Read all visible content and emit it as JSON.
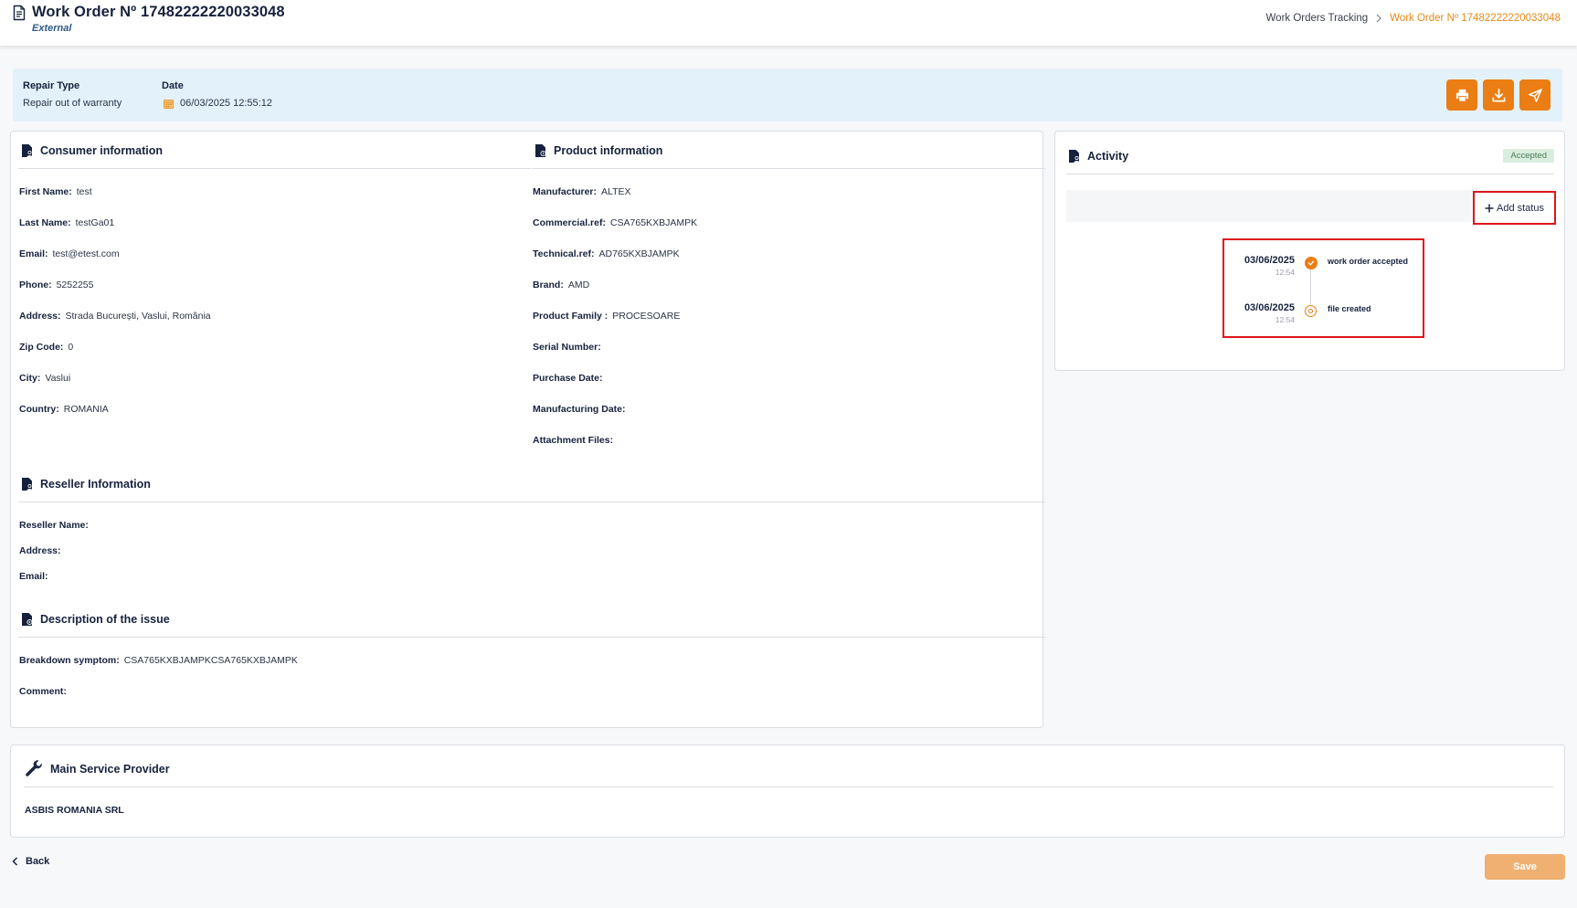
{
  "header": {
    "title": "Work Order Nº 17482222220033048",
    "subtitle": "External",
    "breadcrumb": {
      "parent": "Work Orders Tracking",
      "separator": ">",
      "current": "Work Order Nº 17482222220033048"
    }
  },
  "infobar": {
    "repair_type_label": "Repair Type",
    "repair_type_value": "Repair out of warranty",
    "date_label": "Date",
    "date_value": "06/03/2025 12:55:12",
    "actions": [
      "print-icon",
      "download-icon",
      "send-icon"
    ]
  },
  "consumer": {
    "title": "Consumer information",
    "fields": [
      {
        "label": "First Name:",
        "value": "test"
      },
      {
        "label": "Last Name:",
        "value": "testGa01"
      },
      {
        "label": "Email:",
        "value": "test@etest.com"
      },
      {
        "label": "Phone:",
        "value": "5252255"
      },
      {
        "label": "Address:",
        "value": "Strada București, Vaslui, România"
      },
      {
        "label": "Zip Code:",
        "value": "0"
      },
      {
        "label": "City:",
        "value": "Vaslui"
      },
      {
        "label": "Country:",
        "value": "ROMANIA"
      }
    ]
  },
  "product": {
    "title": "Product information",
    "fields": [
      {
        "label": "Manufacturer:",
        "value": "ALTEX"
      },
      {
        "label": "Commercial.ref:",
        "value": "CSA765KXBJAMPK"
      },
      {
        "label": "Technical.ref:",
        "value": "AD765KXBJAMPK"
      },
      {
        "label": "Brand:",
        "value": "AMD"
      },
      {
        "label": "Product Family :",
        "value": "PROCESOARE"
      },
      {
        "label": "Serial Number:",
        "value": ""
      },
      {
        "label": "Purchase Date:",
        "value": ""
      },
      {
        "label": "Manufacturing Date:",
        "value": ""
      },
      {
        "label": "Attachment Files:",
        "value": ""
      }
    ]
  },
  "reseller": {
    "title": "Reseller Information",
    "fields": [
      {
        "label": "Reseller Name:",
        "value": ""
      },
      {
        "label": "Address:",
        "value": ""
      },
      {
        "label": "Email:",
        "value": ""
      }
    ]
  },
  "issue": {
    "title": "Description of the issue",
    "fields": [
      {
        "label": "Breakdown symptom:",
        "value": "CSA765KXBJAMPKCSA765KXBJAMPK"
      },
      {
        "label": "Comment:",
        "value": ""
      }
    ]
  },
  "activity": {
    "title": "Activity",
    "status_badge": "Accepted",
    "add_status_label": "Add status",
    "timeline": [
      {
        "date": "03/06/2025",
        "time": "12:54",
        "text": "work order accepted",
        "state": "done"
      },
      {
        "date": "03/06/2025",
        "time": "12:54",
        "text": "file created",
        "state": "open"
      }
    ]
  },
  "provider": {
    "title": "Main Service Provider",
    "name": "ASBIS ROMANIA SRL"
  },
  "footer": {
    "back_label": "Back",
    "save_label": "Save"
  },
  "colors": {
    "accent": "#ea7d13",
    "highlight": "#e0141b",
    "infobar_bg": "#e3f1fb",
    "badge_bg": "#d9eedf"
  }
}
